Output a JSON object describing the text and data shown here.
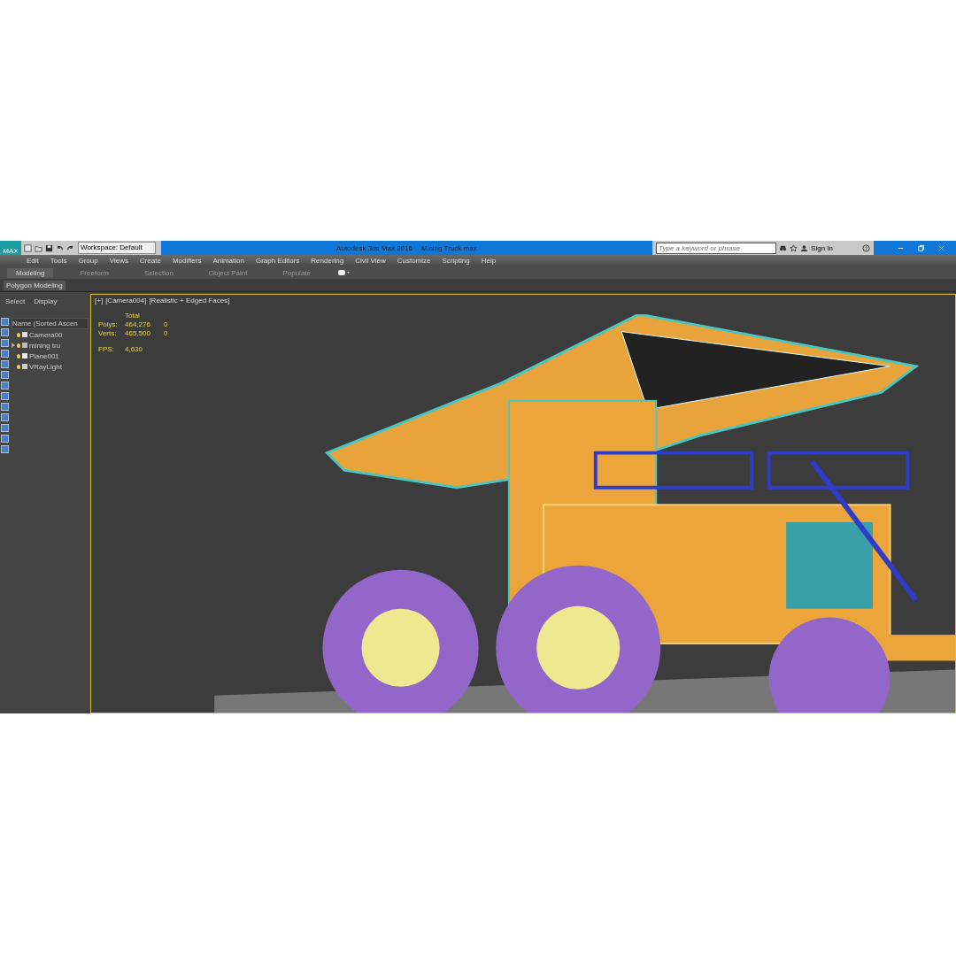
{
  "title_bar": {
    "logo": "MAX",
    "workspace": "Workspace: Default",
    "app_title": "Autodesk 3ds Max 2016",
    "file_name": "Mining Truck.max",
    "search": {
      "placeholder": "Type a keyword or phrase"
    },
    "sign_in": "Sign In"
  },
  "menu": [
    "Edit",
    "Tools",
    "Group",
    "Views",
    "Create",
    "Modifiers",
    "Animation",
    "Graph Editors",
    "Rendering",
    "Civil View",
    "Customize",
    "Scripting",
    "Help"
  ],
  "ribbon_tabs": [
    {
      "label": "Modeling",
      "selected": true
    },
    {
      "label": "Freeform",
      "selected": false
    },
    {
      "label": "Selection",
      "selected": false
    },
    {
      "label": "Object Paint",
      "selected": false
    },
    {
      "label": "Populate",
      "selected": false
    }
  ],
  "ribbon_panel": "Polygon Modeling",
  "scene_explorer": {
    "tabs": [
      "Select",
      "Display"
    ],
    "column": "Name (Sorted Ascen",
    "items": [
      {
        "name": "Camera00",
        "kind": "camera",
        "expandable": false
      },
      {
        "name": "mining tru",
        "kind": "group",
        "expandable": true
      },
      {
        "name": "Plane001",
        "kind": "sphere",
        "expandable": false
      },
      {
        "name": "VRayLight",
        "kind": "light",
        "expandable": false
      }
    ]
  },
  "viewport": {
    "labels": [
      "[+]",
      "[Camera004]",
      "[Realistic + Edged Faces]"
    ],
    "stats": {
      "header": "Total",
      "rows": [
        {
          "label": "Polys:",
          "value": "464,276",
          "selected": "0"
        },
        {
          "label": "Verts:",
          "value": "465,500",
          "selected": "0"
        }
      ],
      "fps_label": "FPS:",
      "fps": "4,630"
    }
  }
}
